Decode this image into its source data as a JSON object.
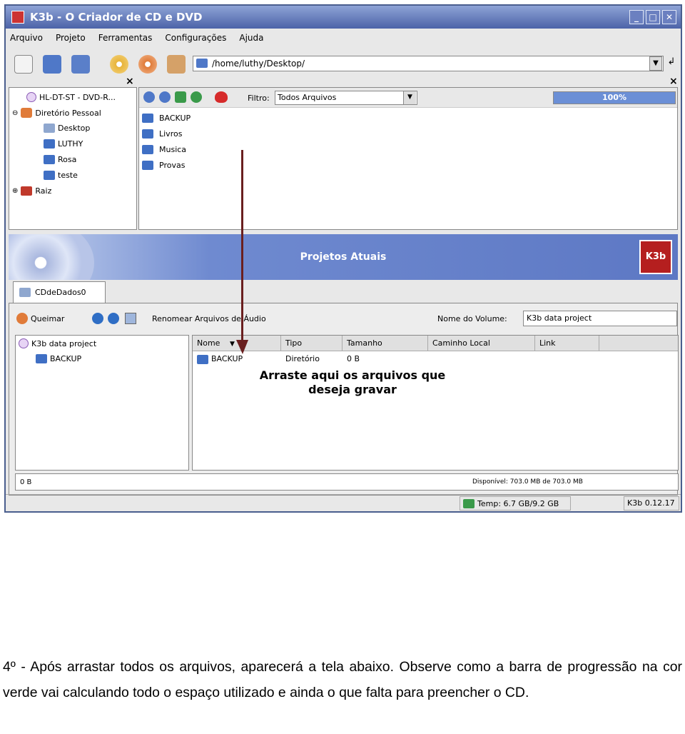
{
  "window": {
    "title": "K3b - O Criador de CD e DVD",
    "buttons": [
      "_",
      "□",
      "✕"
    ]
  },
  "menu": [
    "Arquivo",
    "Projeto",
    "Ferramentas",
    "Configurações",
    "Ajuda"
  ],
  "path": "/home/luthy/Desktop/",
  "tree": {
    "items": [
      {
        "label": "HL-DT-ST - DVD-R...",
        "icon": "cd-drive-icon"
      },
      {
        "label": "Diretório Pessoal",
        "icon": "home-icon"
      },
      {
        "label": "Desktop",
        "icon": "desktop-icon"
      },
      {
        "label": "LUTHY",
        "icon": "folder-icon"
      },
      {
        "label": "Rosa",
        "icon": "folder-icon"
      },
      {
        "label": "teste",
        "icon": "folder-icon"
      },
      {
        "label": "Raiz",
        "icon": "root-folder-icon"
      }
    ]
  },
  "filebrowser": {
    "filter_label": "Filtro:",
    "filter_value": "Todos Arquivos",
    "progress_label": "100%",
    "progress": 1.0,
    "folders": [
      "BACKUP",
      "Livros",
      "Musica",
      "Provas"
    ]
  },
  "projects": {
    "header": "Projetos Atuais",
    "logo": "K3b",
    "tab_label": "CDdeDados0",
    "burn_label": "Queimar",
    "rename_label": "Renomear Arquivos de Áudio",
    "volume_label": "Nome do Volume:",
    "volume_value": "K3b data project",
    "tree_root": "K3b data project",
    "tree_child": "BACKUP",
    "columns": [
      "Nome",
      "Tipo",
      "Tamanho",
      "Caminho Local",
      "Link"
    ],
    "row": {
      "name": "BACKUP",
      "type": "Diretório",
      "size": "0 B",
      "path": "",
      "link": ""
    },
    "drag_msg_line1": "Arraste aqui os arquivos que",
    "drag_msg_line2": "deseja gravar",
    "used": "0 B",
    "available": "Disponível: 703.0 MB de 703.0 MB"
  },
  "statusbar": {
    "temp": "Temp: 6.7 GB/9.2 GB",
    "version": "K3b 0.12.17"
  },
  "caption": "4º - Após arrastar todos os arquivos, aparecerá a tela abaixo. Observe como a barra de progressão na cor verde vai calculando todo o espaço utilizado e ainda o que falta para preencher o CD."
}
